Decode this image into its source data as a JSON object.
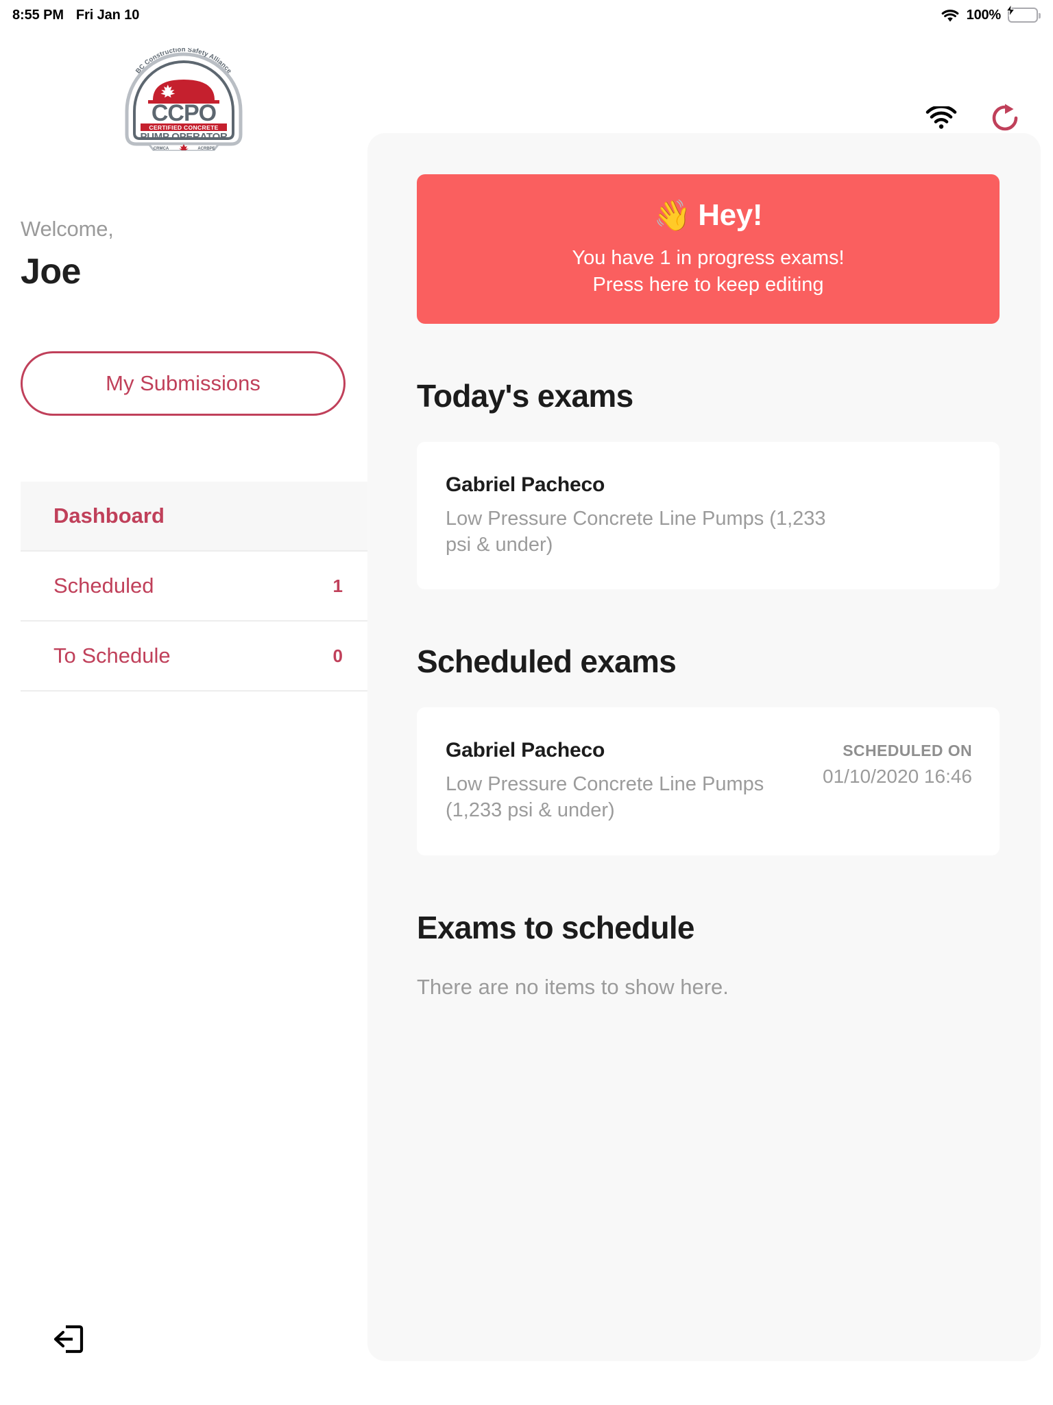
{
  "status_bar": {
    "time": "8:55 PM",
    "date": "Fri Jan 10",
    "battery_percent": "100%",
    "wifi_icon": "wifi-icon",
    "battery_icon": "battery-charging-icon"
  },
  "header": {
    "wifi_icon": "wifi-icon",
    "refresh_icon": "refresh-icon",
    "refresh_color": "#c0405a"
  },
  "sidebar": {
    "logo": {
      "name": "ccpo-logo",
      "arc_text": "BC Construction Safety Alliance",
      "acronym": "CCPO",
      "line1": "CERTIFIED CONCRETE",
      "line2": "PUMP OPERATOR",
      "footer_left": "CRMCA",
      "footer_right": "ACRBPE"
    },
    "welcome_label": "Welcome,",
    "user_name": "Joe",
    "submissions_label": "My Submissions",
    "nav_items": [
      {
        "label": "Dashboard",
        "count": "",
        "active": true
      },
      {
        "label": "Scheduled",
        "count": "1",
        "active": false
      },
      {
        "label": "To Schedule",
        "count": "0",
        "active": false
      }
    ],
    "logout_icon": "logout-icon"
  },
  "main": {
    "banner": {
      "emoji": "👋",
      "title": "Hey!",
      "line1": "You have 1 in progress exams!",
      "line2": "Press here to keep editing",
      "color": "#fa5f5f"
    },
    "sections": [
      {
        "title": "Today's exams",
        "items": [
          {
            "name": "Gabriel Pacheco",
            "subtitle": "Low Pressure Concrete Line Pumps (1,233 psi & under)",
            "meta_label": "",
            "meta_value": ""
          }
        ],
        "empty_text": ""
      },
      {
        "title": "Scheduled exams",
        "items": [
          {
            "name": "Gabriel Pacheco",
            "subtitle": "Low Pressure Concrete Line Pumps (1,233 psi & under)",
            "meta_label": "SCHEDULED ON",
            "meta_value": "01/10/2020 16:46"
          }
        ],
        "empty_text": ""
      },
      {
        "title": "Exams to schedule",
        "items": [],
        "empty_text": "There are no items to show here."
      }
    ]
  }
}
